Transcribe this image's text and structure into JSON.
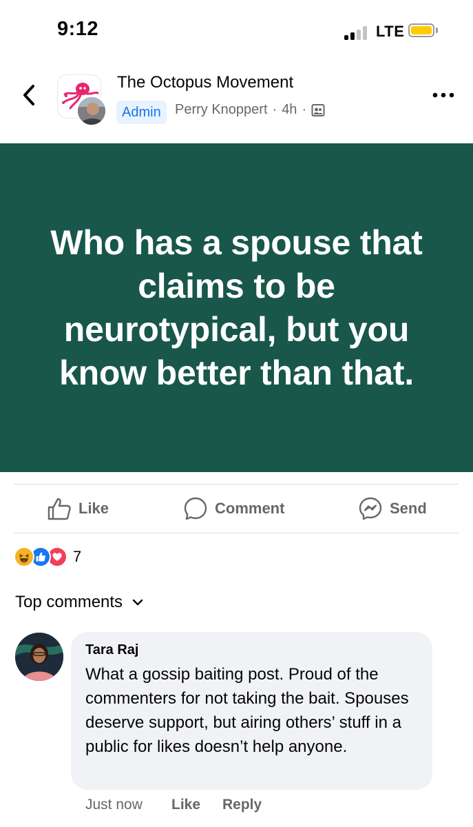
{
  "status_bar": {
    "time": "9:12",
    "network": "LTE",
    "battery_color": "#ffcc00"
  },
  "header": {
    "back_icon": "chevron-left-icon",
    "group_name": "The Octopus Movement",
    "role_badge": "Admin",
    "author": "Perry Knoppert",
    "time_ago": "4h",
    "separator": "·",
    "audience_icon": "group-members-icon",
    "more_icon": "more-horizontal-icon"
  },
  "post": {
    "background_color": "#18574a",
    "text": "Who has a spouse that claims to be neurotypical, but you know better than that."
  },
  "actions": {
    "like": "Like",
    "comment": "Comment",
    "send": "Send"
  },
  "reactions": {
    "types": [
      "haha",
      "like",
      "love"
    ],
    "count": "7"
  },
  "comments_section": {
    "sort_label": "Top comments",
    "comments": [
      {
        "author": "Tara Raj",
        "text": "What a gossip baiting post. Proud of the commenters for not taking the bait. Spouses deserve support, but airing others’ stuff in a public for likes doesn’t help anyone.",
        "time": "Just now",
        "like": "Like",
        "reply": "Reply"
      }
    ]
  },
  "colors": {
    "link_blue": "#1b74e4",
    "secondary_text": "#65676b",
    "bubble_bg": "#f0f2f5"
  }
}
